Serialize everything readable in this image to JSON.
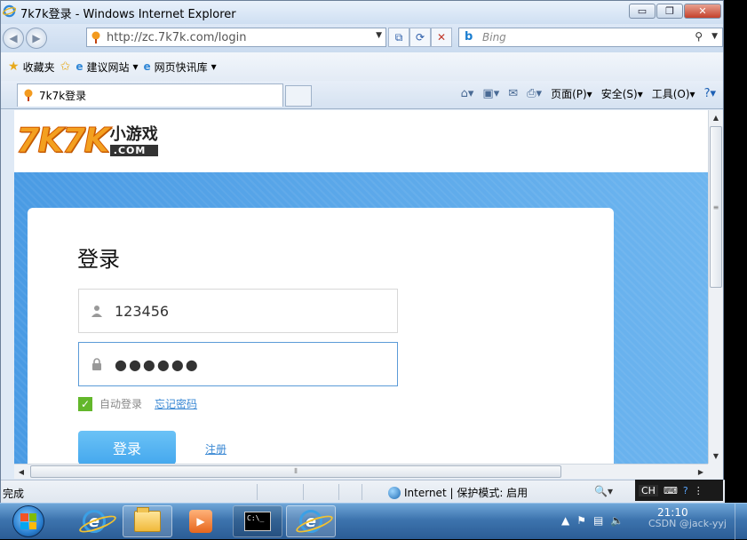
{
  "window": {
    "title": "7k7k登录 - Windows Internet Explorer",
    "btn_min": "▭",
    "btn_max": "❐",
    "btn_close": "✕"
  },
  "nav": {
    "url": "http://zc.7k7k.com/login",
    "search_placeholder": "Bing"
  },
  "favorites": {
    "fav_label": "收藏夹",
    "suggested": "建议网站",
    "webslice": "网页快讯库"
  },
  "tab": {
    "title": "7k7k登录"
  },
  "commands": {
    "page": "页面(P)",
    "safety": "安全(S)",
    "tools": "工具(O)"
  },
  "page": {
    "logo_main": "7K7K",
    "logo_sub": "小游戏",
    "logo_com": ".COM",
    "heading": "登录",
    "username_value": "123456",
    "password_value": "●●●●●●",
    "remember_label": "自动登录",
    "forgot_link": "忘记密码",
    "login_button": "登录",
    "register_link": "注册"
  },
  "status": {
    "done": "完成",
    "zone": "Internet | 保护模式: 启用",
    "zoom": "🔍▾"
  },
  "tray": {
    "lang": "CH",
    "time": "21:10"
  },
  "watermark": "CSDN @jack-yyj",
  "colors": {
    "accent_blue": "#4a9be4",
    "checkbox_green": "#63b72b",
    "button_blue": "#45a8ee"
  }
}
